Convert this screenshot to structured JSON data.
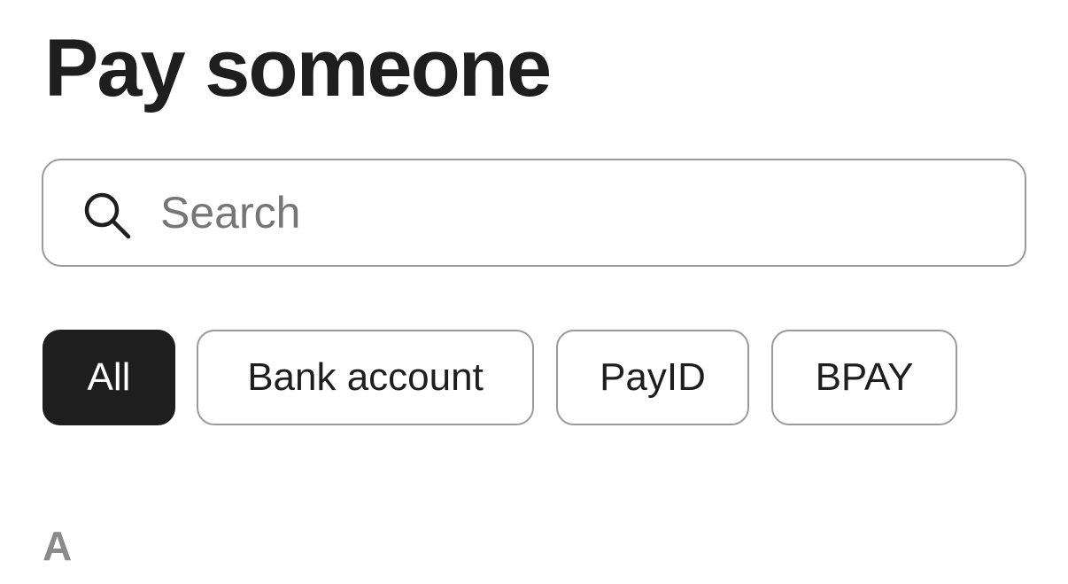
{
  "header": {
    "title": "Pay someone"
  },
  "search": {
    "icon": "search-icon",
    "placeholder": "Search",
    "value": ""
  },
  "filters": {
    "selected": "All",
    "items": [
      {
        "label": "All",
        "active": true
      },
      {
        "label": "Bank account",
        "active": false
      },
      {
        "label": "PayID",
        "active": false
      },
      {
        "label": "BPAY",
        "active": false
      }
    ]
  },
  "list": {
    "section_header": "A"
  },
  "colors": {
    "text_primary": "#1e1e1e",
    "border": "#9a9a9a",
    "placeholder": "#767676",
    "section_header": "#8a8a8a",
    "active_chip_bg": "#1e1e1e",
    "active_chip_text": "#ffffff"
  }
}
